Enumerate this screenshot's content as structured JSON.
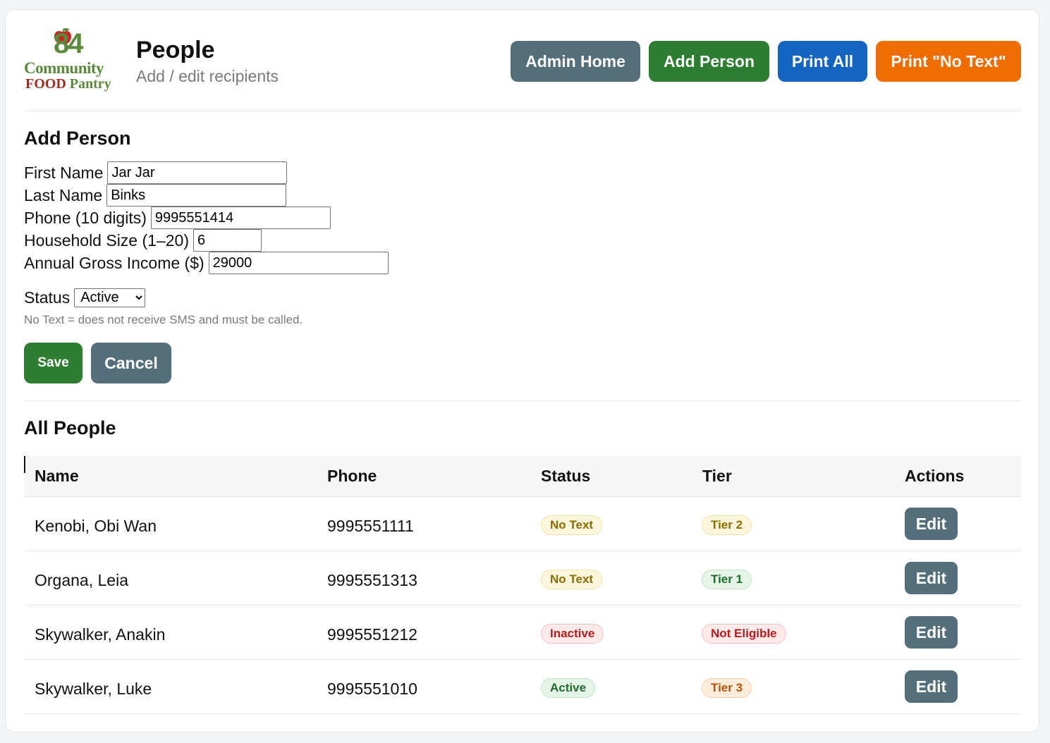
{
  "brand": {
    "logo_number": "84",
    "logo_line1": "Community",
    "logo_line2a": "FOOD",
    "logo_line2b": " Pantry"
  },
  "header": {
    "title": "People",
    "subtitle": "Add / edit recipients",
    "buttons": {
      "admin_home": "Admin Home",
      "add_person": "Add Person",
      "print_all": "Print All",
      "print_no_text": "Print \"No Text\""
    }
  },
  "form": {
    "heading": "Add Person",
    "first_name": {
      "label": "First Name",
      "value": "Jar Jar"
    },
    "last_name": {
      "label": "Last Name",
      "value": "Binks"
    },
    "phone": {
      "label": "Phone (10 digits)",
      "value": "9995551414"
    },
    "household": {
      "label": "Household Size (1–20)",
      "value": "6"
    },
    "income": {
      "label": "Annual Gross Income ($)",
      "value": "29000"
    },
    "status": {
      "label": "Status",
      "value": "Active"
    },
    "hint": "No Text = does not receive SMS and must be called.",
    "save": "Save",
    "cancel": "Cancel"
  },
  "list": {
    "heading": "All People",
    "columns": [
      "Name",
      "Phone",
      "Status",
      "Tier",
      "Actions"
    ],
    "rows": [
      {
        "name": "Kenobi, Obi Wan",
        "phone": "9995551111",
        "status": "No Text",
        "tier": "Tier 2",
        "action": "Edit"
      },
      {
        "name": "Organa, Leia",
        "phone": "9995551313",
        "status": "No Text",
        "tier": "Tier 1",
        "action": "Edit"
      },
      {
        "name": "Skywalker, Anakin",
        "phone": "9995551212",
        "status": "Inactive",
        "tier": "Not Eligible",
        "action": "Edit"
      },
      {
        "name": "Skywalker, Luke",
        "phone": "9995551010",
        "status": "Active",
        "tier": "Tier 3",
        "action": "Edit"
      }
    ]
  },
  "colors": {
    "gray_button": "#546e7a",
    "green_button": "#2e7d32",
    "blue_button": "#1565c0",
    "orange_button": "#ef6c00"
  }
}
